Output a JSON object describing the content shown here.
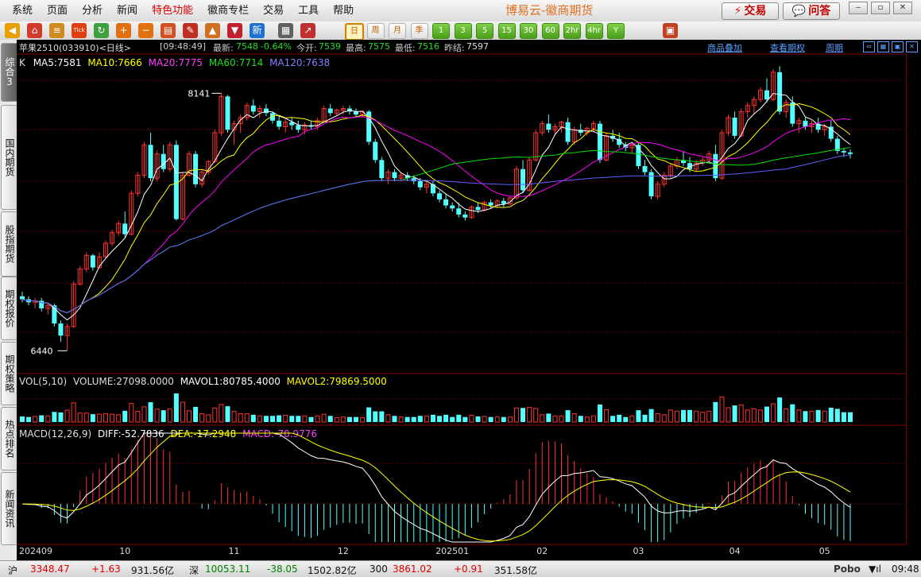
{
  "menu": [
    "系统",
    "页面",
    "分析",
    "新闻",
    "特色功能",
    "徽商专栏",
    "交易",
    "工具",
    "帮助"
  ],
  "menu_special_index": 4,
  "app_title": "博易云-徽商期货",
  "buttons": {
    "trade": "交易",
    "ask": "问答"
  },
  "toolbar_icons": [
    "back-arrow-icon",
    "home-icon",
    "database-icon",
    "tick-chart-icon",
    "refresh-icon",
    "zoom-in-icon",
    "zoom-out-icon",
    "notes-icon",
    "pen-icon",
    "paint-icon",
    "filter-icon",
    "new-icon",
    "table-icon",
    "line-trend-icon"
  ],
  "toolbar_tick_label": "Tick",
  "toolbar_new_label": "新",
  "periods": [
    "日",
    "周",
    "月",
    "季",
    "1",
    "3",
    "5",
    "15",
    "30",
    "60",
    "2hr",
    "4hr",
    "Y"
  ],
  "left_tabs": [
    "综合3",
    "国内期货",
    "股指期货",
    "期权报价",
    "期权策略",
    "热点排名",
    "新闻资讯"
  ],
  "header": {
    "instrument": "苹果2510(033910)<日线>",
    "time": "[09:48:49]",
    "latest_label": "最新:",
    "latest": "7548",
    "change": "-0.64%",
    "open_label": "今开:",
    "open": "7539",
    "high_label": "最高:",
    "high": "7575",
    "low_label": "最低:",
    "low": "7516",
    "prev_label": "昨结:",
    "prev": "7597",
    "link_overlay": "商品叠加",
    "link_options": "查看期权",
    "link_period": "周期"
  },
  "price_legend": {
    "k": "K",
    "ma5": "MA5:7581",
    "ma10": "MA10:7666",
    "ma20": "MA20:7775",
    "ma60": "MA60:7714",
    "ma120": "MA120:7638"
  },
  "vol_legend": {
    "label": "VOL(5,10)",
    "volume": "VOLUME:27098.0000",
    "mavol1": "MAVOL1:80785.4000",
    "mavol2": "MAVOL2:79869.5000"
  },
  "macd_legend": {
    "label": "MACD(12,26,9)",
    "diff": "DIFF:-52.7836",
    "dea": "DEA:-17.2948",
    "macd": "MACD:-70.9776"
  },
  "markers": {
    "high": "8141",
    "low": "6440"
  },
  "x_axis_labels": [
    "202409",
    "10",
    "11",
    "12",
    "202501",
    "02",
    "03",
    "04",
    "05"
  ],
  "status": {
    "sh_label": "沪",
    "sh_index": "3348.47",
    "sh_change": "+1.63",
    "sh_amount": "931.56亿",
    "sz_label": "深",
    "sz_index": "10053.11",
    "sz_change": "-38.05",
    "sz_amount": "1502.82亿",
    "c300_label": "300",
    "c300_index": "3861.02",
    "c300_change": "+0.91",
    "c300_amount": "351.58亿",
    "brand": "Pobo",
    "clock": "09:48"
  },
  "colors": {
    "up": "#ff3232",
    "down": "#54ffff",
    "ma5": "#ffffff",
    "ma10": "#ffff00",
    "ma20": "#ff00ff",
    "ma60": "#00e000",
    "ma120": "#6060ff"
  },
  "chart_data": {
    "type": "candlestick",
    "note_series": "daily candles for 苹果2510, approximate",
    "candles": [
      [
        6800,
        6830,
        6760,
        6780
      ],
      [
        6780,
        6800,
        6740,
        6760
      ],
      [
        6760,
        6790,
        6720,
        6770
      ],
      [
        6770,
        6790,
        6700,
        6720
      ],
      [
        6720,
        6760,
        6680,
        6740
      ],
      [
        6740,
        6750,
        6600,
        6620
      ],
      [
        6620,
        6640,
        6500,
        6540
      ],
      [
        6540,
        6620,
        6440,
        6600
      ],
      [
        6600,
        6900,
        6590,
        6880
      ],
      [
        6880,
        7000,
        6870,
        6980
      ],
      [
        6980,
        7090,
        6960,
        7070
      ],
      [
        7070,
        7080,
        6970,
        6990
      ],
      [
        6990,
        7090,
        6980,
        7060
      ],
      [
        7060,
        7170,
        7050,
        7150
      ],
      [
        7150,
        7240,
        7130,
        7220
      ],
      [
        7220,
        7300,
        7200,
        7280
      ],
      [
        7280,
        7360,
        7190,
        7210
      ],
      [
        7210,
        7500,
        7200,
        7480
      ],
      [
        7480,
        7620,
        7460,
        7600
      ],
      [
        7600,
        7820,
        7580,
        7800
      ],
      [
        7800,
        7880,
        7560,
        7580
      ],
      [
        7580,
        7760,
        7560,
        7740
      ],
      [
        7740,
        7800,
        7620,
        7640
      ],
      [
        7640,
        7820,
        7620,
        7800
      ],
      [
        7800,
        7830,
        7300,
        7310
      ],
      [
        7310,
        7620,
        7300,
        7600
      ],
      [
        7600,
        7760,
        7590,
        7740
      ],
      [
        7740,
        7760,
        7520,
        7540
      ],
      [
        7540,
        7640,
        7520,
        7620
      ],
      [
        7620,
        7700,
        7600,
        7690
      ],
      [
        7690,
        7900,
        7680,
        7880
      ],
      [
        7880,
        8141,
        7860,
        8120
      ],
      [
        8120,
        8130,
        7880,
        7900
      ],
      [
        7900,
        7960,
        7800,
        7940
      ],
      [
        7940,
        8000,
        7880,
        7980
      ],
      [
        7980,
        8080,
        7960,
        8060
      ],
      [
        8060,
        8100,
        8000,
        8020
      ],
      [
        8020,
        8060,
        7980,
        8040
      ],
      [
        8040,
        8070,
        7990,
        8010
      ],
      [
        8010,
        8020,
        7940,
        7960
      ],
      [
        7960,
        7990,
        7900,
        7920
      ],
      [
        7920,
        7970,
        7880,
        7950
      ],
      [
        7950,
        7980,
        7900,
        7930
      ],
      [
        7930,
        7960,
        7880,
        7900
      ],
      [
        7900,
        7950,
        7870,
        7930
      ],
      [
        7930,
        7960,
        7900,
        7920
      ],
      [
        7920,
        7980,
        7900,
        7960
      ],
      [
        7960,
        8060,
        7950,
        8040
      ],
      [
        8040,
        8070,
        7990,
        8010
      ],
      [
        8010,
        8040,
        7990,
        8030
      ],
      [
        8030,
        8060,
        8000,
        8040
      ],
      [
        8040,
        8060,
        8000,
        8020
      ],
      [
        8020,
        8040,
        7980,
        8000
      ],
      [
        8000,
        8030,
        7980,
        8020
      ],
      [
        8020,
        8030,
        7800,
        7820
      ],
      [
        7820,
        7840,
        7680,
        7700
      ],
      [
        7700,
        7720,
        7560,
        7580
      ],
      [
        7580,
        7640,
        7540,
        7620
      ],
      [
        7620,
        7640,
        7560,
        7580
      ],
      [
        7580,
        7620,
        7560,
        7600
      ],
      [
        7600,
        7620,
        7560,
        7580
      ],
      [
        7580,
        7600,
        7540,
        7560
      ],
      [
        7560,
        7580,
        7500,
        7520
      ],
      [
        7520,
        7560,
        7480,
        7540
      ],
      [
        7540,
        7560,
        7460,
        7480
      ],
      [
        7480,
        7500,
        7420,
        7440
      ],
      [
        7440,
        7480,
        7380,
        7400
      ],
      [
        7400,
        7420,
        7360,
        7380
      ],
      [
        7380,
        7420,
        7320,
        7340
      ],
      [
        7340,
        7360,
        7300,
        7320
      ],
      [
        7320,
        7400,
        7310,
        7390
      ],
      [
        7390,
        7420,
        7350,
        7370
      ],
      [
        7370,
        7430,
        7360,
        7420
      ],
      [
        7420,
        7440,
        7380,
        7400
      ],
      [
        7400,
        7440,
        7380,
        7430
      ],
      [
        7430,
        7450,
        7390,
        7410
      ],
      [
        7410,
        7460,
        7400,
        7450
      ],
      [
        7450,
        7660,
        7440,
        7640
      ],
      [
        7640,
        7700,
        7480,
        7500
      ],
      [
        7500,
        7720,
        7490,
        7700
      ],
      [
        7700,
        7900,
        7690,
        7880
      ],
      [
        7880,
        7960,
        7860,
        7940
      ],
      [
        7940,
        8000,
        7880,
        7900
      ],
      [
        7900,
        7940,
        7860,
        7920
      ],
      [
        7920,
        7960,
        7880,
        7950
      ],
      [
        7950,
        7980,
        7800,
        7820
      ],
      [
        7820,
        7920,
        7800,
        7900
      ],
      [
        7900,
        7940,
        7860,
        7880
      ],
      [
        7880,
        7920,
        7860,
        7910
      ],
      [
        7910,
        7960,
        7880,
        7940
      ],
      [
        7940,
        7960,
        7680,
        7700
      ],
      [
        7700,
        7880,
        7690,
        7860
      ],
      [
        7860,
        7900,
        7820,
        7840
      ],
      [
        7840,
        7880,
        7780,
        7800
      ],
      [
        7800,
        7820,
        7760,
        7780
      ],
      [
        7780,
        7820,
        7740,
        7800
      ],
      [
        7800,
        7820,
        7640,
        7660
      ],
      [
        7660,
        7700,
        7600,
        7620
      ],
      [
        7620,
        7640,
        7440,
        7460
      ],
      [
        7460,
        7560,
        7440,
        7540
      ],
      [
        7540,
        7620,
        7520,
        7600
      ],
      [
        7600,
        7680,
        7580,
        7660
      ],
      [
        7660,
        7720,
        7640,
        7700
      ],
      [
        7700,
        7760,
        7660,
        7680
      ],
      [
        7680,
        7720,
        7620,
        7640
      ],
      [
        7640,
        7700,
        7620,
        7680
      ],
      [
        7680,
        7720,
        7660,
        7700
      ],
      [
        7700,
        7760,
        7680,
        7740
      ],
      [
        7740,
        7800,
        7560,
        7580
      ],
      [
        7580,
        7900,
        7570,
        7880
      ],
      [
        7880,
        8000,
        7860,
        7980
      ],
      [
        7980,
        8020,
        7840,
        7860
      ],
      [
        7860,
        8040,
        7850,
        8020
      ],
      [
        8020,
        8080,
        7980,
        8060
      ],
      [
        8060,
        8120,
        8000,
        8100
      ],
      [
        8100,
        8180,
        8080,
        8160
      ],
      [
        8160,
        8240,
        8080,
        8100
      ],
      [
        8100,
        8300,
        8090,
        8280
      ],
      [
        8280,
        8320,
        8000,
        8020
      ],
      [
        8020,
        8100,
        7980,
        8080
      ],
      [
        8080,
        8120,
        7920,
        7940
      ],
      [
        7940,
        7980,
        7880,
        7960
      ],
      [
        7960,
        7980,
        7900,
        7920
      ],
      [
        7920,
        7960,
        7880,
        7940
      ],
      [
        7940,
        7980,
        7880,
        7900
      ],
      [
        7900,
        7940,
        7860,
        7920
      ],
      [
        7920,
        7960,
        7820,
        7840
      ],
      [
        7840,
        7860,
        7740,
        7760
      ],
      [
        7760,
        7780,
        7720,
        7750
      ],
      [
        7750,
        7770,
        7710,
        7740
      ]
    ],
    "y_range": [
      6300,
      8400
    ]
  }
}
